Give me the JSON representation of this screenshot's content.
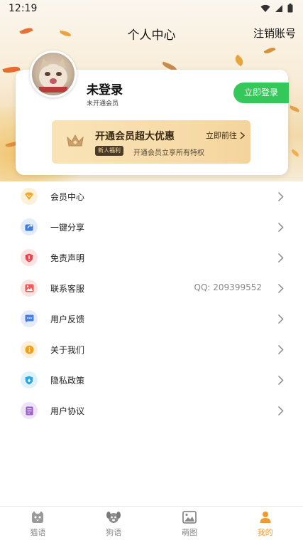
{
  "status_bar": {
    "time": "12:19"
  },
  "header": {
    "title": "个人中心",
    "logout_label": "注销账号"
  },
  "profile": {
    "username": "未登录",
    "member_status": "未开通会员",
    "login_button": "立即登录"
  },
  "promo": {
    "headline": "开通会员超大优惠",
    "tag": "新人福利",
    "subtitle": "开通会员立享所有特权",
    "action": "立即前往"
  },
  "menu": [
    {
      "label": "会员中心",
      "icon": "vip-diamond-icon",
      "color": "#f5a623",
      "bg": "#fdf1dc",
      "extra": ""
    },
    {
      "label": "一键分享",
      "icon": "share-icon",
      "color": "#3b7ddd",
      "bg": "#e3ecfa",
      "extra": ""
    },
    {
      "label": "免责声明",
      "icon": "shield-alert-icon",
      "color": "#e5484d",
      "bg": "#fbe2e2",
      "extra": ""
    },
    {
      "label": "联系客服",
      "icon": "image-icon",
      "color": "#ef5a5a",
      "bg": "#fbe3e0",
      "extra": "QQ: 209399552"
    },
    {
      "label": "用户反馈",
      "icon": "feedback-chat-icon",
      "color": "#4a7fe0",
      "bg": "#e4ecfb",
      "extra": ""
    },
    {
      "label": "关于我们",
      "icon": "info-icon",
      "color": "#f0a020",
      "bg": "#fdf0da",
      "extra": ""
    },
    {
      "label": "隐私政策",
      "icon": "privacy-shield-icon",
      "color": "#2aa7e0",
      "bg": "#def2fb",
      "extra": ""
    },
    {
      "label": "用户协议",
      "icon": "document-icon",
      "color": "#9b59d0",
      "bg": "#efe3f8",
      "extra": ""
    }
  ],
  "bottom_nav": [
    {
      "label": "猫语",
      "icon": "cat-icon",
      "active": false
    },
    {
      "label": "狗语",
      "icon": "dog-icon",
      "active": false
    },
    {
      "label": "萌图",
      "icon": "picture-icon",
      "active": false
    },
    {
      "label": "我的",
      "icon": "user-icon",
      "active": true
    }
  ],
  "colors": {
    "accent": "#34c759",
    "active_tab": "#f39a2e",
    "promo_gold": "#f7dcaa"
  }
}
